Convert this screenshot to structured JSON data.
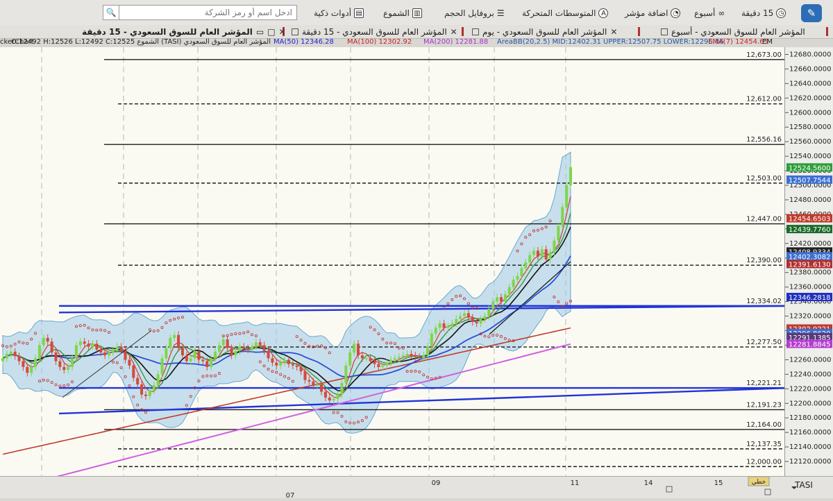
{
  "toolbar": {
    "interval": "15 دقيقة",
    "period": "أسبوع",
    "add_indicator": "اضافة مؤشر",
    "moving_averages": "المتوسطات المتحركة",
    "volume_profile": "بروفايل الحجم",
    "candles": "الشموع",
    "smart_tools": "أدوات ذكية",
    "search_placeholder": "ادخل اسم أو رمز الشركة"
  },
  "tabs": [
    {
      "label": "المؤشر العام للسوق السعودي - أسبوع"
    },
    {
      "label": "المؤشر العام للسوق السعودي - يوم"
    },
    {
      "label": "المؤشر العام للسوق السعودي - 15 دقيقة"
    }
  ],
  "indicators": {
    "app": "ckerChart",
    "ohlc": "المؤشر العام للسوق السعودي (TASI) الشموع O:12492 H:12526 L:12492 C:12525",
    "ma50": "MA(50)  12346.28",
    "ma100": "MA(100)  12302.92",
    "ma200": "MA(200)  12281.88",
    "bb": "AreaBB(20,2.5)  MID:12402.31  UPPER:12507.75  LOWER:12296.86",
    "ema7": "EMA(7)  12454.65",
    "ema": "EM",
    "colors": {
      "ohlc": "#222222",
      "ma50": "#2222cc",
      "ma100": "#cc2222",
      "ma200": "#aa33cc",
      "bb": "#2255aa",
      "ema7": "#cc2222"
    }
  },
  "chart_data": {
    "type": "candlestick",
    "title": "المؤشر العام للسوق السعودي - 15 دقيقة",
    "symbol": "TASI",
    "ylim": [
      12100,
      12690
    ],
    "y_ticks": [
      12680,
      12660,
      12640,
      12620,
      12600,
      12580,
      12560,
      12540,
      12520,
      12500,
      12480,
      12460,
      12440,
      12420,
      12400,
      12380,
      12360,
      12340,
      12320,
      12300,
      12280,
      12260,
      12240,
      12220,
      12200,
      12180,
      12160,
      12140,
      12120
    ],
    "x_labels": [
      "07",
      "09",
      "11",
      "14",
      "15"
    ],
    "horizontal_levels": [
      {
        "value": 12673.0,
        "label": "12,673.00",
        "style": "solid"
      },
      {
        "value": 12612.0,
        "label": "12,612.00",
        "style": "dashed"
      },
      {
        "value": 12556.16,
        "label": "12,556.16",
        "style": "solid"
      },
      {
        "value": 12503.0,
        "label": "12,503.00",
        "style": "dashed"
      },
      {
        "value": 12447.0,
        "label": "12,447.00",
        "style": "solid"
      },
      {
        "value": 12390.0,
        "label": "12,390.00",
        "style": "dashed"
      },
      {
        "value": 12334.02,
        "label": "12,334.02",
        "style": "blue"
      },
      {
        "value": 12277.5,
        "label": "12,277.50",
        "style": "dashed"
      },
      {
        "value": 12221.21,
        "label": "12,221.21",
        "style": "blue"
      },
      {
        "value": 12191.23,
        "label": "12,191.23",
        "style": "solid"
      },
      {
        "value": 12164.0,
        "label": "12,164.00",
        "style": "solid"
      },
      {
        "value": 12137.35,
        "label": "12,137.35",
        "style": "dashed"
      },
      {
        "value": 12113.0,
        "label": "12,000.00",
        "style": "dashed"
      }
    ],
    "channel": {
      "upper": [
        12325,
        12334
      ],
      "lower": [
        12186,
        12221
      ]
    },
    "price_tags": [
      {
        "value": 12524.56,
        "label": "12524.5600",
        "color": "#2e9e3a"
      },
      {
        "value": 12507.75,
        "label": "12507.7544",
        "color": "#3b6fd1"
      },
      {
        "value": 12454.65,
        "label": "12454.6503",
        "color": "#c0392b"
      },
      {
        "value": 12439.78,
        "label": "12439.7760",
        "color": "#1d6b2a"
      },
      {
        "value": 12408.93,
        "label": "12408.9334",
        "color": "#222222"
      },
      {
        "value": 12402.31,
        "label": "12402.3082",
        "color": "#3b6fd1"
      },
      {
        "value": 12391.61,
        "label": "12391.6130",
        "color": "#b03030"
      },
      {
        "value": 12346.28,
        "label": "12346.2818",
        "color": "#1f2fbf"
      },
      {
        "value": 12302.92,
        "label": "12302.9221",
        "color": "#c0392b"
      },
      {
        "value": 12296.86,
        "label": "12296.8620",
        "color": "#3b6fd1"
      },
      {
        "value": 12291.14,
        "label": "12291.1385",
        "color": "#5a3a7a"
      },
      {
        "value": 12281.88,
        "label": "12281.8845",
        "color": "#b43ccf"
      }
    ],
    "closes": [
      12262,
      12268,
      12271,
      12265,
      12258,
      12250,
      12242,
      12250,
      12262,
      12280,
      12290,
      12285,
      12270,
      12258,
      12250,
      12246,
      12250,
      12262,
      12280,
      12285,
      12282,
      12278,
      12282,
      12274,
      12270,
      12266,
      12270,
      12274,
      12278,
      12274,
      12260,
      12252,
      12235,
      12226,
      12212,
      12210,
      12218,
      12225,
      12240,
      12262,
      12276,
      12290,
      12294,
      12276,
      12266,
      12258,
      12262,
      12272,
      12260,
      12258,
      12250,
      12262,
      12271,
      12280,
      12288,
      12276,
      12266,
      12272,
      12278,
      12276,
      12274,
      12278,
      12284,
      12280,
      12272,
      12262,
      12256,
      12252,
      12256,
      12260,
      12254,
      12252,
      12250,
      12244,
      12232,
      12230,
      12224,
      12226,
      12216,
      12208,
      12204,
      12206,
      12212,
      12228,
      12252,
      12270,
      12282,
      12266,
      12262,
      12262,
      12258,
      12254,
      12250,
      12252,
      12256,
      12260,
      12262,
      12264,
      12266,
      12268,
      12266,
      12264,
      12262,
      12266,
      12278,
      12296,
      12304,
      12310,
      12304,
      12306,
      12310,
      12316,
      12320,
      12324,
      12318,
      12312,
      12310,
      12316,
      12320,
      12330,
      12340,
      12346,
      12340,
      12350,
      12360,
      12370,
      12375,
      12386,
      12394,
      12404,
      12410,
      12402,
      12412,
      12398,
      12408,
      12424,
      12444,
      12470,
      12500,
      12525
    ],
    "overlays": [
      "MA(50)",
      "MA(100)",
      "MA(200)",
      "AreaBB(20,2.5)",
      "EMA(7)"
    ],
    "footer": {
      "symbol": "TASI",
      "badge": "خطي"
    }
  }
}
